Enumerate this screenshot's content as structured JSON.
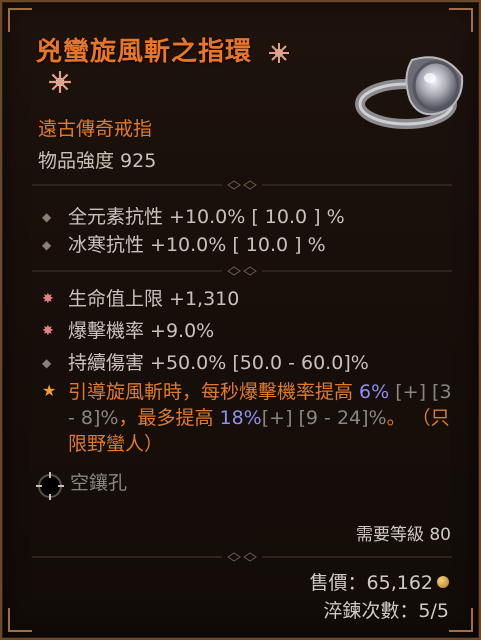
{
  "item": {
    "name": "兇蠻旋風斬之指環",
    "type": "遠古傳奇戒指",
    "power_label": "物品強度 925"
  },
  "stats_implicit": [
    {
      "text": "全元素抗性 +10.0%  [ 10.0 ] %"
    },
    {
      "text": "冰寒抗性 +10.0%  [ 10.0 ] %"
    }
  ],
  "stats_affixes": [
    {
      "text": "生命值上限 +1,310"
    },
    {
      "text": "爆擊機率 +9.0%"
    },
    {
      "text": "持續傷害 +50.0% [50.0 - 60.0]%"
    }
  ],
  "aspect": {
    "part1": "引導旋風斬時，每秒爆擊機率提高 ",
    "v1": "6%",
    "range1": "[+] [3 - 8]%",
    "part2": "，最多提高 ",
    "v2": "18%",
    "range2": "[+] [9 - 24]%",
    "part3": "。 （只限野蠻人）"
  },
  "socket": {
    "label": "空鑲孔"
  },
  "requirement": {
    "label": "需要等級 80"
  },
  "sell": {
    "label": "售價：65,162"
  },
  "temper": {
    "label": "淬鍊次數：5/5"
  },
  "colors": {
    "legendary_orange": "#e8762a",
    "stat_text": "#c8c2ba",
    "greater_affix_blue": "#8f8ff0",
    "border": "#6b4a2c"
  }
}
